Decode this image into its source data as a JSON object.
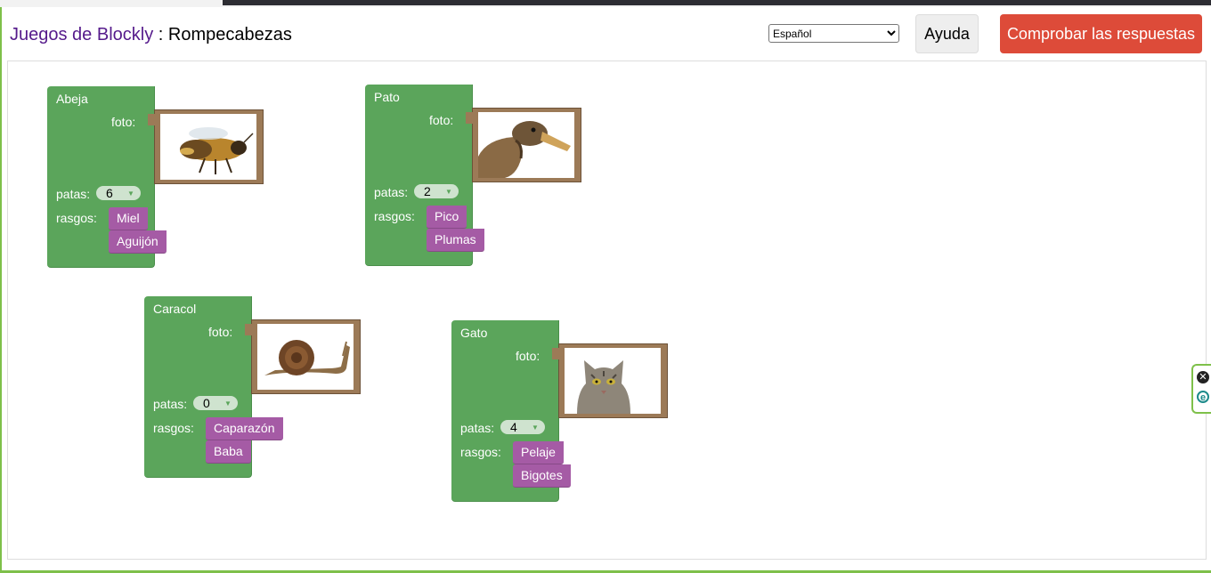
{
  "header": {
    "app_name": "Juegos de Blockly",
    "separator": " : ",
    "page_name": "Rompecabezas",
    "language": "Español",
    "help_label": "Ayuda",
    "check_label": "Comprobar las respuestas"
  },
  "labels": {
    "photo": "foto:",
    "legs": "patas:",
    "traits": "rasgos:"
  },
  "animals": [
    {
      "name": "Abeja",
      "legs": "6",
      "traits": [
        "Miel",
        "Aguijón"
      ],
      "photo_icon": "bee-photo"
    },
    {
      "name": "Pato",
      "legs": "2",
      "traits": [
        "Pico",
        "Plumas"
      ],
      "photo_icon": "duck-photo"
    },
    {
      "name": "Caracol",
      "legs": "0",
      "traits": [
        "Caparazón",
        "Baba"
      ],
      "photo_icon": "snail-photo"
    },
    {
      "name": "Gato",
      "legs": "4",
      "traits": [
        "Pelaje",
        "Bigotes"
      ],
      "photo_icon": "cat-photo"
    }
  ],
  "colors": {
    "block": "#5ba55b",
    "trait": "#a55ba5",
    "photo_frame": "#9c7a57",
    "check_button": "#dd4b39"
  }
}
